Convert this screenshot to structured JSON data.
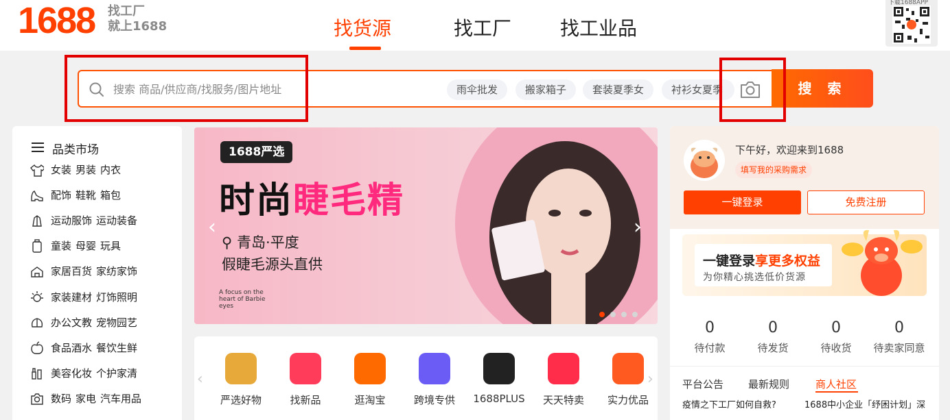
{
  "logo": {
    "number": "1688",
    "slogan_line1": "找工厂",
    "slogan_line2": "就上1688"
  },
  "nav": {
    "tabs": [
      "找货源",
      "找工厂",
      "找工业品"
    ],
    "active": 0
  },
  "app_download": {
    "label": "下载1688APP"
  },
  "search": {
    "placeholder": "搜索 商品/供应商/找服务/图片地址",
    "hot_tags": [
      "雨伞批发",
      "搬家箱子",
      "套装夏季女",
      "衬衫女夏季"
    ],
    "button_label": "搜 索"
  },
  "categories": {
    "title": "品类市场",
    "rows": [
      {
        "icon": "tshirt-icon",
        "items": [
          "女装",
          "男装",
          "内衣"
        ]
      },
      {
        "icon": "high-heel-icon",
        "items": [
          "配饰",
          "鞋靴",
          "箱包"
        ]
      },
      {
        "icon": "sports-icon",
        "items": [
          "运动服饰",
          "运动装备"
        ]
      },
      {
        "icon": "baby-icon",
        "items": [
          "童装",
          "母婴",
          "玩具"
        ]
      },
      {
        "icon": "home-icon",
        "items": [
          "家居百货",
          "家纺家饰"
        ]
      },
      {
        "icon": "lamp-icon",
        "items": [
          "家装建材",
          "灯饰照明"
        ]
      },
      {
        "icon": "office-icon",
        "items": [
          "办公文教",
          "宠物园艺"
        ]
      },
      {
        "icon": "food-icon",
        "items": [
          "食品酒水",
          "餐饮生鲜"
        ]
      },
      {
        "icon": "beauty-icon",
        "items": [
          "美容化妆",
          "个护家清"
        ]
      },
      {
        "icon": "camera-icon",
        "items": [
          "数码",
          "家电",
          "汽车用品"
        ]
      }
    ]
  },
  "banner": {
    "badge": "1688严选",
    "headline_part1": "时尚",
    "headline_part2": "睫毛精",
    "location": "青岛·平度",
    "subtitle": "假睫毛源头直供",
    "fine_print": "A focus on the heart of Barbie eyes",
    "slide_count": 4,
    "active_slide": 0
  },
  "services": [
    {
      "label": "严选好物",
      "color": "#e8a93b"
    },
    {
      "label": "找新品",
      "color": "#ff3d5a"
    },
    {
      "label": "逛淘宝",
      "color": "#ff6a00"
    },
    {
      "label": "跨境专供",
      "color": "#6a5cf5"
    },
    {
      "label": "1688PLUS",
      "color": "#222222"
    },
    {
      "label": "天天特卖",
      "color": "#ff2d4a"
    },
    {
      "label": "实力优品",
      "color": "#ff5a1f"
    }
  ],
  "user_panel": {
    "greeting": "下午好，欢迎来到1688",
    "request_tag": "填写我的采购需求",
    "login_button": "一键登录",
    "register_button": "免费注册",
    "promo_title_part1": "一键登录",
    "promo_title_part2": "享更多权益",
    "promo_subtitle": "为你精心挑选低价货源",
    "orders": [
      {
        "count": "0",
        "label": "待付款"
      },
      {
        "count": "0",
        "label": "待发货"
      },
      {
        "count": "0",
        "label": "待收货"
      },
      {
        "count": "0",
        "label": "待卖家同意"
      }
    ],
    "notice_tabs": [
      "平台公告",
      "最新规则",
      "商人社区"
    ],
    "notice_active": 2,
    "notices": [
      "疫情之下工厂如何自救?",
      "1688中小企业「纾困计划」深"
    ]
  },
  "colors": {
    "brand": "#ff4000",
    "highlight_box": "#e30000"
  }
}
